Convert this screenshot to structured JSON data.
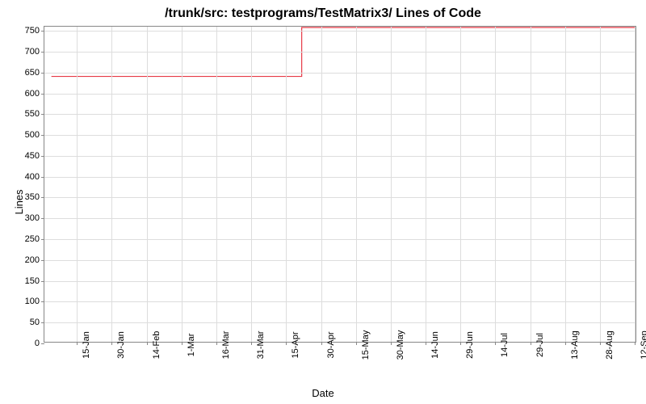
{
  "chart_data": {
    "type": "line",
    "title": "/trunk/src: testprograms/TestMatrix3/ Lines of Code",
    "xlabel": "Date",
    "ylabel": "Lines",
    "ylim": [
      0,
      760
    ],
    "y_ticks": [
      0,
      50,
      100,
      150,
      200,
      250,
      300,
      350,
      400,
      450,
      500,
      550,
      600,
      650,
      700,
      750
    ],
    "x_ticks": [
      "15-Jan",
      "30-Jan",
      "14-Feb",
      "1-Mar",
      "16-Mar",
      "31-Mar",
      "15-Apr",
      "30-Apr",
      "15-May",
      "30-May",
      "14-Jun",
      "29-Jun",
      "14-Jul",
      "29-Jul",
      "13-Aug",
      "28-Aug",
      "12-Sep"
    ],
    "x_range_days": [
      0,
      255
    ],
    "x_tick_days": [
      14,
      29,
      44,
      59,
      74,
      89,
      104,
      119,
      134,
      149,
      164,
      179,
      194,
      209,
      224,
      239,
      254
    ],
    "series": [
      {
        "name": "lines",
        "color": "#e63946",
        "points_days": [
          [
            3,
            640
          ],
          [
            111,
            640
          ],
          [
            111,
            758
          ],
          [
            255,
            758
          ]
        ]
      }
    ]
  }
}
